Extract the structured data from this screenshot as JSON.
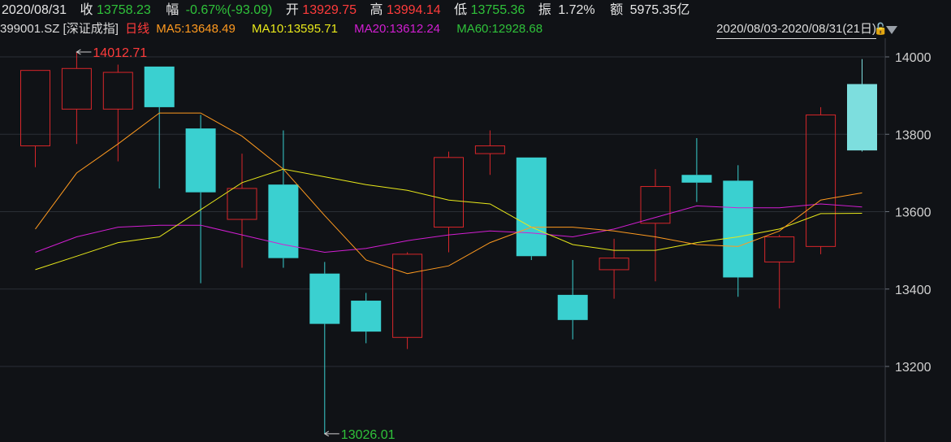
{
  "header": {
    "date": "2020/08/31",
    "close_label": "收",
    "close_value": "13758.23",
    "change_label": "幅",
    "change_value": "-0.67%(-93.09)",
    "open_label": "开",
    "open_value": "13929.75",
    "high_label": "高",
    "high_value": "13994.14",
    "low_label": "低",
    "low_value": "13755.36",
    "amp_label": "振",
    "amp_value": "1.72%",
    "amount_label": "额",
    "amount_value": "5975.35亿"
  },
  "subheader": {
    "symbol": "399001.SZ [深证成指]",
    "period": "日线",
    "ma5": "MA5:13648.49",
    "ma10": "MA10:13595.71",
    "ma20": "MA20:13612.24",
    "ma60": "MA60:12928.68",
    "range": "2020/08/03-2020/08/31(21日)"
  },
  "colors": {
    "up": "#d8262a",
    "down": "#3ad0d0",
    "last": "#7ddede",
    "ma5": "#ff9a1f",
    "ma10": "#e8e81a",
    "ma20": "#d21ed2",
    "grid": "#2a2e35",
    "axis_text": "#d0d0d0"
  },
  "chart_data": {
    "type": "candlestick",
    "ylim": [
      13000,
      14100
    ],
    "yticks": [
      13200,
      13400,
      13600,
      13800,
      14000
    ],
    "candles": [
      {
        "o": 13770,
        "c": 13965,
        "h": 13965,
        "l": 13715
      },
      {
        "o": 13865,
        "c": 13970,
        "h": 14012.71,
        "l": 13775
      },
      {
        "o": 13865,
        "c": 13960,
        "h": 13980,
        "l": 13730
      },
      {
        "o": 13975,
        "c": 13870,
        "h": 13975,
        "l": 13660
      },
      {
        "o": 13815,
        "c": 13650,
        "h": 13850,
        "l": 13415
      },
      {
        "o": 13580,
        "c": 13660,
        "h": 13750,
        "l": 13455
      },
      {
        "o": 13670,
        "c": 13480,
        "h": 13810,
        "l": 13455
      },
      {
        "o": 13440,
        "c": 13310,
        "h": 13470,
        "l": 13026.01
      },
      {
        "o": 13370,
        "c": 13290,
        "h": 13390,
        "l": 13260
      },
      {
        "o": 13275,
        "c": 13490,
        "h": 13495,
        "l": 13245
      },
      {
        "o": 13560,
        "c": 13740,
        "h": 13755,
        "l": 13495
      },
      {
        "o": 13750,
        "c": 13770,
        "h": 13810,
        "l": 13695
      },
      {
        "o": 13740,
        "c": 13485,
        "h": 13740,
        "l": 13475
      },
      {
        "o": 13385,
        "c": 13320,
        "h": 13475,
        "l": 13270
      },
      {
        "o": 13450,
        "c": 13480,
        "h": 13530,
        "l": 13375
      },
      {
        "o": 13570,
        "c": 13665,
        "h": 13710,
        "l": 13420
      },
      {
        "o": 13695,
        "c": 13675,
        "h": 13790,
        "l": 13625
      },
      {
        "o": 13680,
        "c": 13430,
        "h": 13720,
        "l": 13380
      },
      {
        "o": 13470,
        "c": 13535,
        "h": 13540,
        "l": 13350
      },
      {
        "o": 13510,
        "c": 13850,
        "h": 13870,
        "l": 13490
      },
      {
        "o": 13929.75,
        "c": 13758.23,
        "h": 13994.14,
        "l": 13755.36
      }
    ],
    "ma5": [
      13555,
      13700,
      13775,
      13855,
      13855,
      13795,
      13710,
      13590,
      13475,
      13440,
      13460,
      13520,
      13560,
      13560,
      13550,
      13535,
      13515,
      13510,
      13550,
      13630,
      13648.49
    ],
    "ma10": [
      13450,
      13485,
      13520,
      13535,
      13605,
      13675,
      13710,
      13690,
      13670,
      13655,
      13630,
      13620,
      13560,
      13515,
      13500,
      13500,
      13520,
      13535,
      13555,
      13595,
      13595.71
    ],
    "ma20": [
      13495,
      13535,
      13560,
      13565,
      13565,
      13540,
      13515,
      13495,
      13505,
      13525,
      13540,
      13550,
      13545,
      13535,
      13555,
      13585,
      13615,
      13610,
      13610,
      13620,
      13612.24
    ],
    "annotations": {
      "high_label": "14012.71",
      "low_label": "13026.01"
    }
  }
}
